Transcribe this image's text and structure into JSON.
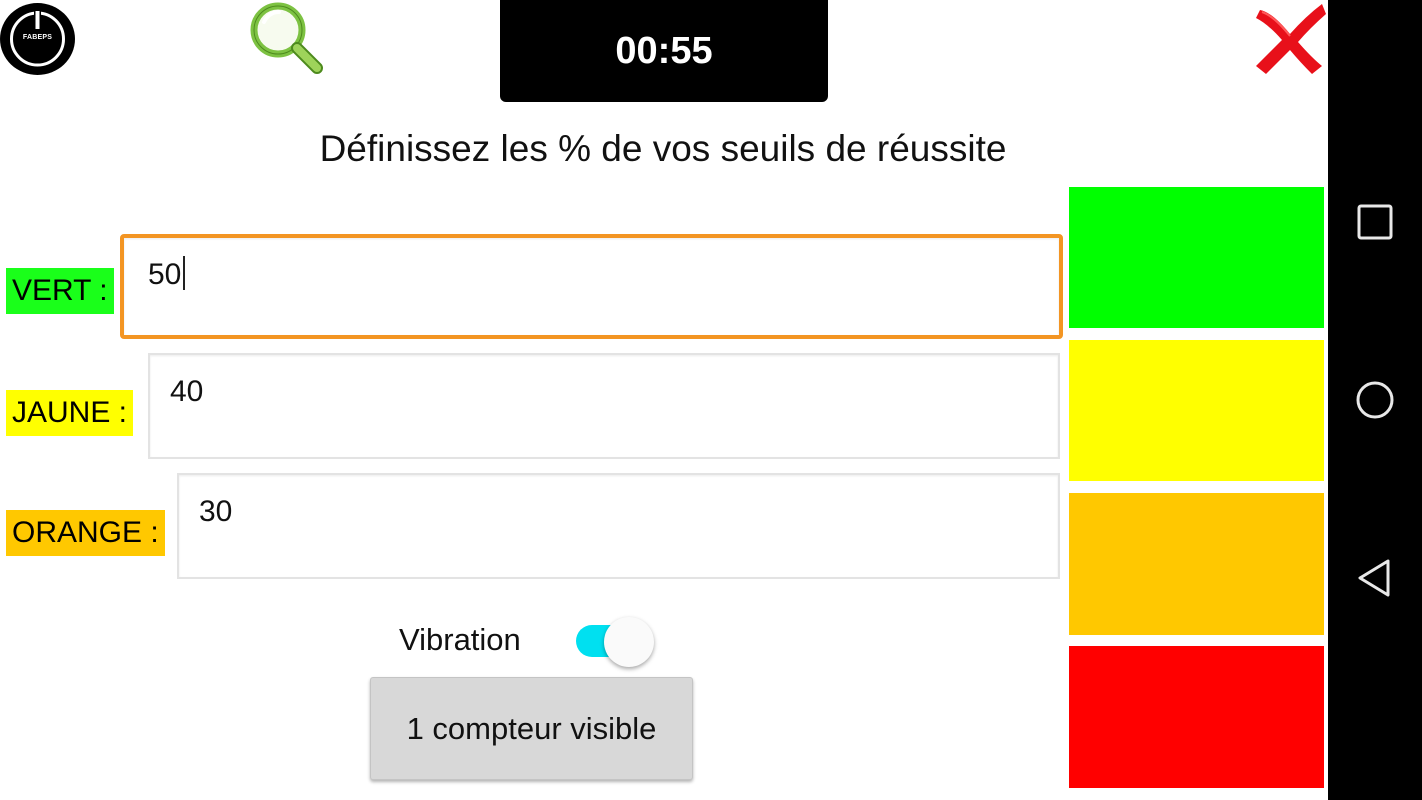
{
  "header": {
    "power_label": "FABEPS",
    "timer": "00:55"
  },
  "title": "Définissez les % de vos seuils de réussite",
  "thresholds": [
    {
      "label": "VERT :",
      "value": "50",
      "color": "#1aff1a"
    },
    {
      "label": "JAUNE :",
      "value": "40",
      "color": "#ffff00"
    },
    {
      "label": "ORANGE :",
      "value": "30",
      "color": "#ffc800"
    }
  ],
  "swatches": [
    "#00ff00",
    "#ffff00",
    "#ffc800",
    "#ff0000"
  ],
  "vibration": {
    "label": "Vibration",
    "enabled": true
  },
  "counter_button": "1 compteur visible",
  "colors": {
    "accent_focus": "#f39523",
    "toggle_on": "#00e0f0",
    "close": "#e8101a",
    "search": "#7dc242"
  },
  "navbar": {
    "icons": [
      "recents-icon",
      "home-icon",
      "back-icon"
    ]
  }
}
